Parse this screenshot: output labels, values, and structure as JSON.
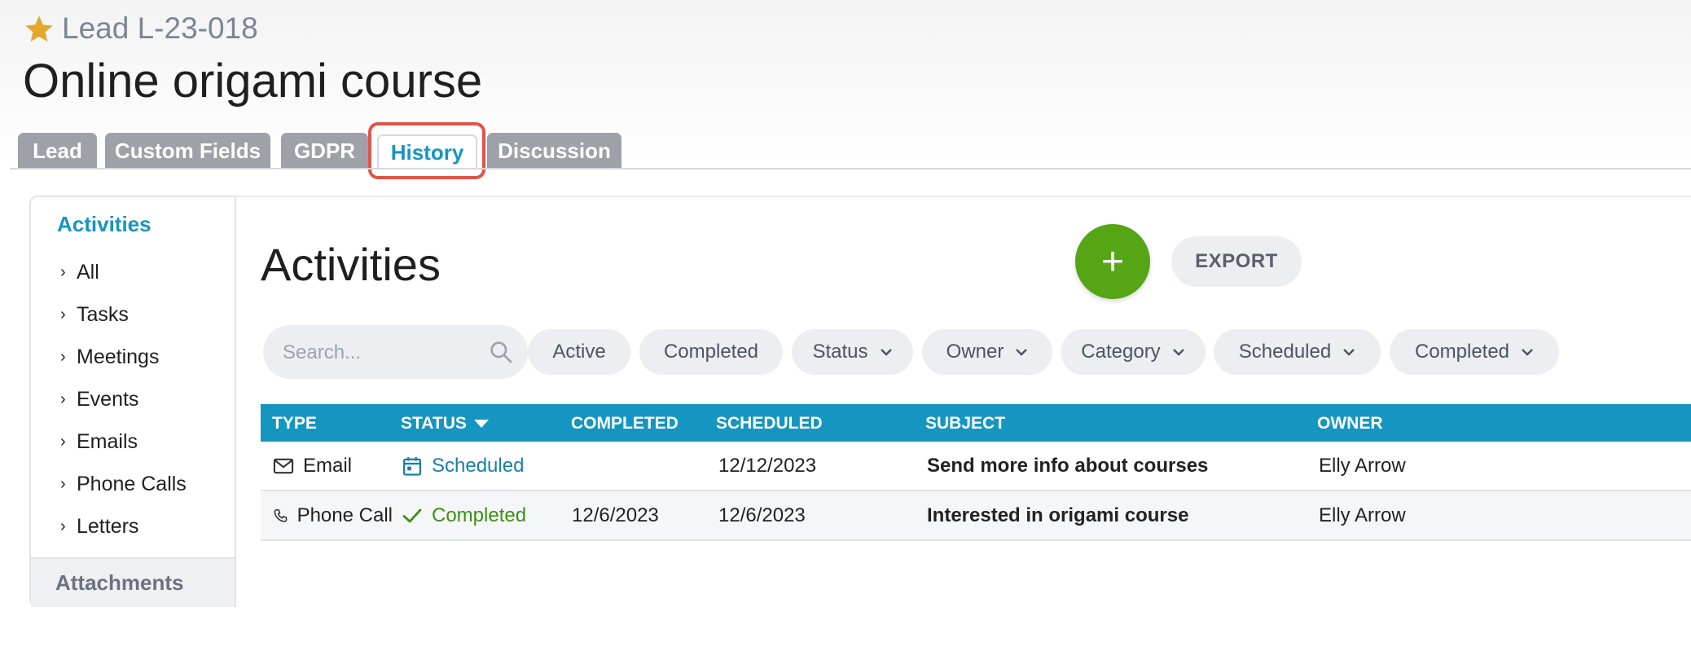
{
  "header": {
    "lead_id": "Lead L-23-018",
    "title": "Online origami course"
  },
  "tabs": [
    {
      "label": "Lead"
    },
    {
      "label": "Custom Fields"
    },
    {
      "label": "GDPR"
    },
    {
      "label": "History",
      "active": true
    },
    {
      "label": "Discussion"
    }
  ],
  "sidebar": {
    "title": "Activities",
    "items": [
      {
        "label": "All"
      },
      {
        "label": "Tasks"
      },
      {
        "label": "Meetings"
      },
      {
        "label": "Events"
      },
      {
        "label": "Emails"
      },
      {
        "label": "Phone Calls"
      },
      {
        "label": "Letters"
      }
    ],
    "attachments": "Attachments"
  },
  "main": {
    "heading": "Activities",
    "add_label": "+",
    "export_label": "EXPORT",
    "search": {
      "value": "",
      "placeholder": "Search..."
    },
    "filters": [
      {
        "label": "Active"
      },
      {
        "label": "Completed"
      },
      {
        "label": "Status"
      },
      {
        "label": "Owner"
      },
      {
        "label": "Category"
      },
      {
        "label": "Scheduled"
      },
      {
        "label": "Completed"
      }
    ]
  },
  "table": {
    "columns": [
      "TYPE",
      "STATUS",
      "COMPLETED",
      "SCHEDULED",
      "SUBJECT",
      "OWNER"
    ],
    "rows": [
      {
        "type": "Email",
        "status": "Scheduled",
        "completed": "",
        "scheduled": "12/12/2023",
        "subject": "Send more info about courses",
        "owner": "Elly Arrow"
      },
      {
        "type": "Phone Call",
        "status": "Completed",
        "completed": "12/6/2023",
        "scheduled": "12/6/2023",
        "subject": "Interested in origami course",
        "owner": "Elly Arrow"
      }
    ]
  },
  "colors": {
    "accent": "#1596c0",
    "add_button": "#55a515",
    "star": "#e3a82b",
    "tab_highlight": "#e0554a",
    "completed_status": "#3c8e16"
  },
  "icons": {
    "favorite": "star-icon",
    "search": "search-icon",
    "email": "envelope-icon",
    "phone": "phone-icon",
    "scheduled": "calendar-icon",
    "completed": "checkmark-icon"
  }
}
